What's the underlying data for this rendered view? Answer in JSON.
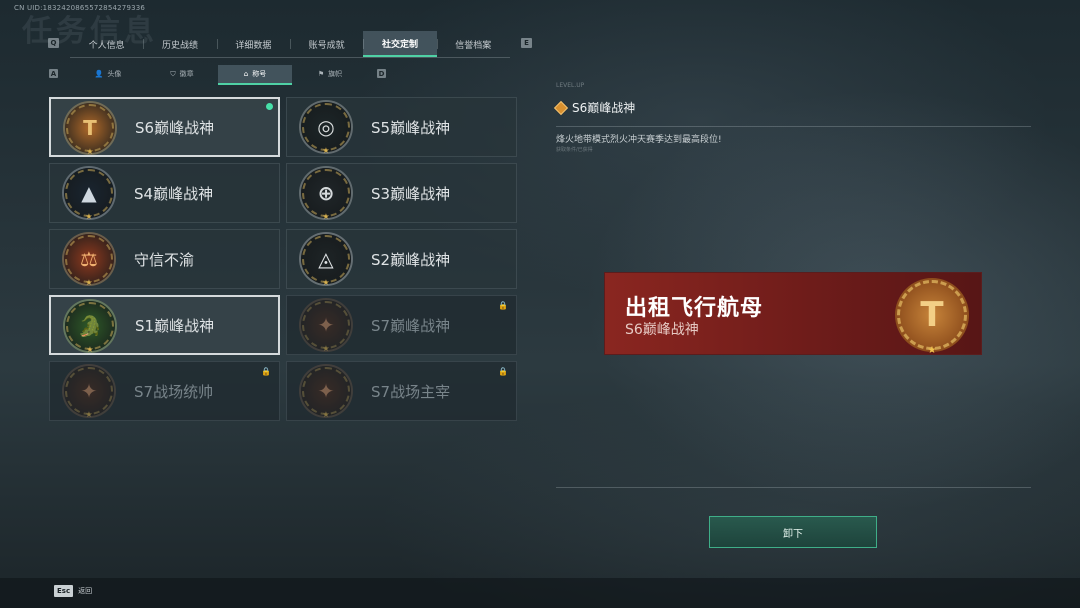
{
  "header": {
    "uid": "CN UID:1832420865572854279336",
    "bg_title": "任务信息",
    "key_left": "Q",
    "key_right": "E"
  },
  "tabs": [
    {
      "label": "个人信息"
    },
    {
      "label": "历史战绩"
    },
    {
      "label": "详细数据"
    },
    {
      "label": "账号成就"
    },
    {
      "label": "社交定制",
      "active": true
    },
    {
      "label": "信誉档案"
    }
  ],
  "subtabs": {
    "key_left": "A",
    "key_right": "D",
    "items": [
      {
        "label": "头像",
        "icon": "person-icon"
      },
      {
        "label": "徽章",
        "icon": "badge-icon"
      },
      {
        "label": "称号",
        "icon": "title-icon",
        "active": true
      },
      {
        "label": "旗帜",
        "icon": "flag-icon"
      }
    ]
  },
  "titles": [
    {
      "name": "S6巅峰战神",
      "selected": true,
      "equipped": true,
      "badge": "T",
      "color": "#b06a2a",
      "accent": "#e9c074"
    },
    {
      "name": "S5巅峰战神",
      "badge": "◎",
      "color": "#1d2628",
      "accent": "#d8dcdc"
    },
    {
      "name": "S4巅峰战神",
      "badge": "▲",
      "color": "#1a2530",
      "accent": "#cfd8e0"
    },
    {
      "name": "S3巅峰战神",
      "badge": "⊕",
      "color": "#202629",
      "accent": "#d6dadc"
    },
    {
      "name": "守信不渝",
      "badge": "⚖",
      "color": "#8f3a1e",
      "accent": "#f0b070"
    },
    {
      "name": "S2巅峰战神",
      "badge": "◬",
      "color": "#1e2426",
      "accent": "#e0e4e6"
    },
    {
      "name": "S1巅峰战神",
      "selected": true,
      "badge": "🐊",
      "color": "#2f5a28",
      "accent": "#bfe08a"
    },
    {
      "name": "S7巅峰战神",
      "locked": true,
      "badge": "✦",
      "color": "#4a2a1e",
      "accent": "#c88a62"
    },
    {
      "name": "S7战场统帅",
      "locked": true,
      "badge": "✦",
      "color": "#4a2a1e",
      "accent": "#c88a62"
    },
    {
      "name": "S7战场主宰",
      "locked": true,
      "badge": "✦",
      "color": "#4a2a1e",
      "accent": "#c88a62"
    }
  ],
  "detail": {
    "small_label": "LEVEL.UP",
    "title": "S6巅峰战神",
    "description": "烽火地带模式烈火冲天赛季达到最高段位!",
    "sub_description": "获取条件/已获得"
  },
  "nameplate": {
    "player_name": "出租飞行航母",
    "title": "S6巅峰战神"
  },
  "actions": {
    "unequip_label": "卸下"
  },
  "footer": {
    "esc_key": "Esc",
    "back_label": "返回"
  }
}
